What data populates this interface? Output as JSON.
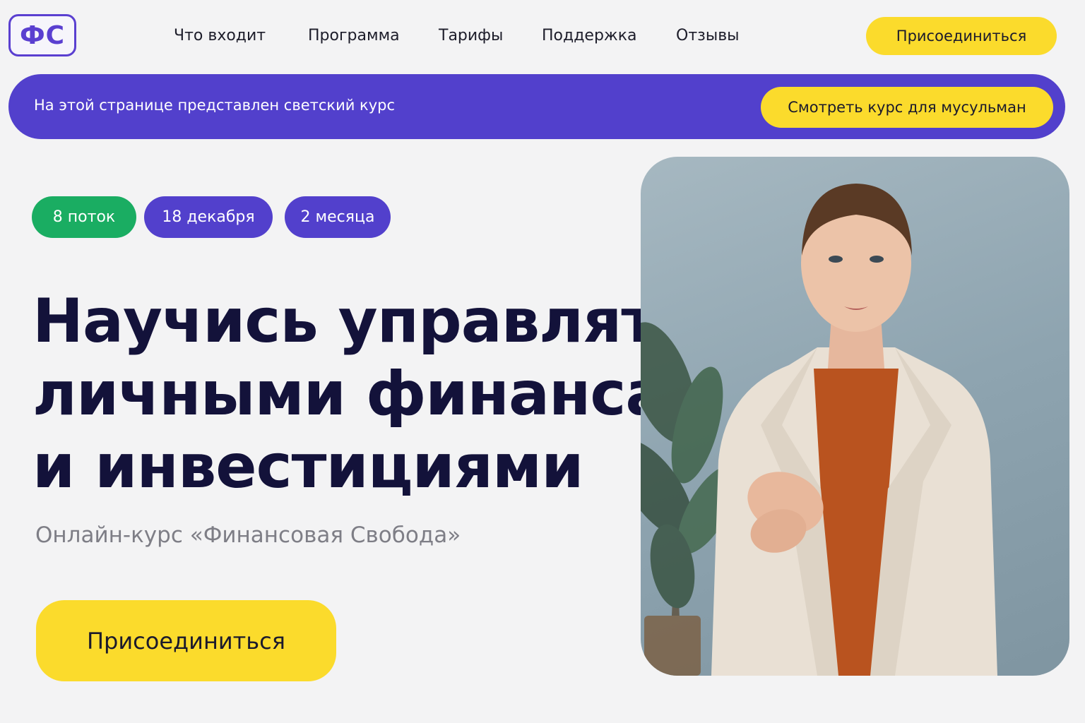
{
  "header": {
    "logo": "ФС",
    "nav": [
      "Что входит",
      "Программа",
      "Тарифы",
      "Поддержка",
      "Отзывы"
    ],
    "join_label": "Присоединиться"
  },
  "banner": {
    "text": "На этой странице представлен светский курс",
    "button_label": "Смотреть курс для мусульман"
  },
  "chips": [
    "8 поток",
    "18 декабря",
    "2 месяца"
  ],
  "hero": {
    "headline": [
      "Научись управлять",
      "личными финансами",
      "и инвестициями"
    ],
    "subtitle": "Онлайн-курс «Финансовая Свобода»",
    "cta_label": "Присоединиться"
  },
  "colors": {
    "accent_purple": "#5240cc",
    "accent_yellow": "#fbdb2c",
    "accent_green": "#1aad62",
    "headline": "#13123a"
  }
}
